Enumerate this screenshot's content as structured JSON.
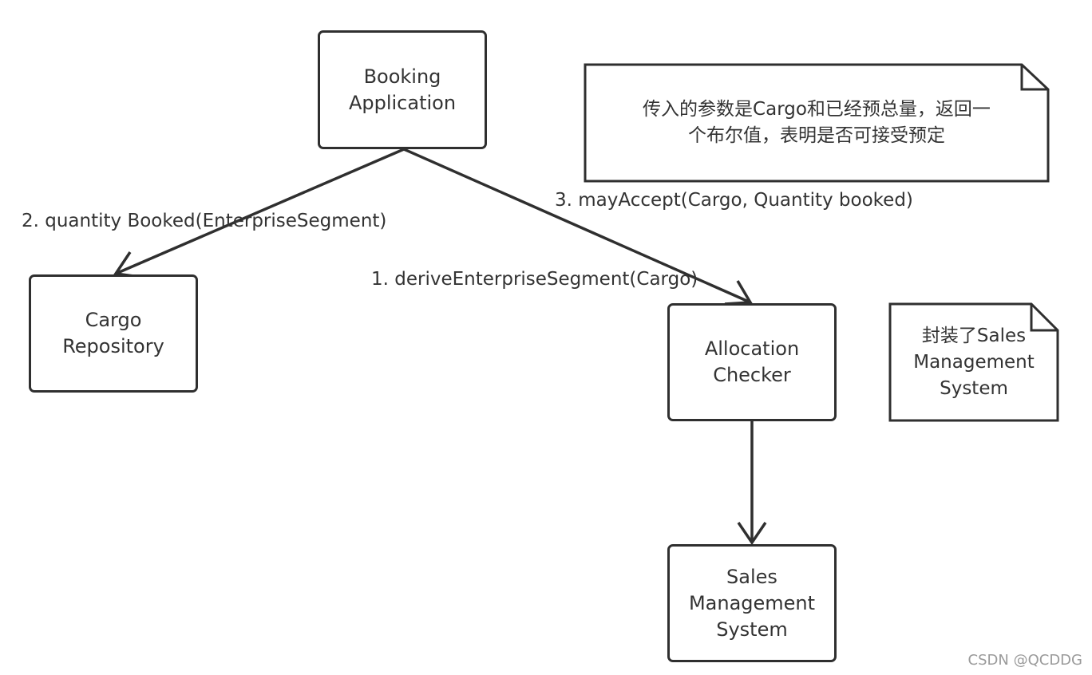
{
  "colors": {
    "stroke": "#2f2f2f",
    "text": "#333333",
    "background": "#ffffff",
    "watermark": "#9a9a9a"
  },
  "nodes": {
    "booking_application": "Booking\nApplication",
    "cargo_repository": "Cargo\nRepository",
    "allocation_checker": "Allocation\nChecker",
    "sales_management_system": "Sales\nManagement\nSystem"
  },
  "messages": {
    "derive_segment": "1. deriveEnterpriseSegment(Cargo)",
    "quantity_booked": "2. quantity Booked(EnterpriseSegment)",
    "may_accept": "3. mayAccept(Cargo, Quantity booked)"
  },
  "notes": {
    "may_accept_note": "传入的参数是Cargo和已经预总量，返回一\n个布尔值，表明是否可接受预定",
    "sales_wrapper_note": "封装了Sales\nManagement\nSystem"
  },
  "watermark": "CSDN @QCDDG"
}
